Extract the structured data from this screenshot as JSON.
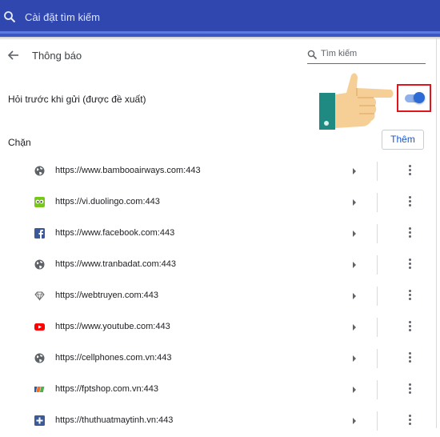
{
  "header": {
    "search_placeholder": "Cài đặt tìm kiếm",
    "search_icon": "search-icon"
  },
  "subpage": {
    "back_icon": "arrow-back-icon",
    "title": "Thông báo",
    "search_placeholder": "Tìm kiếm"
  },
  "ask_setting": {
    "label": "Hỏi trước khi gửi (được đề xuất)",
    "enabled": true,
    "toggle_color": "#2c6ad6",
    "highlight_color": "#e0161c"
  },
  "blocked": {
    "label": "Chặn",
    "add_button": "Thêm",
    "sites": [
      {
        "url": "https://www.bambooairways.com:443",
        "icon": "globe-icon"
      },
      {
        "url": "https://vi.duolingo.com:443",
        "icon": "duolingo-icon"
      },
      {
        "url": "https://www.facebook.com:443",
        "icon": "facebook-icon"
      },
      {
        "url": "https://www.tranbadat.com:443",
        "icon": "globe-icon"
      },
      {
        "url": "https://webtruyen.com:443",
        "icon": "diamond-icon"
      },
      {
        "url": "https://www.youtube.com:443",
        "icon": "youtube-icon"
      },
      {
        "url": "https://cellphones.com.vn:443",
        "icon": "globe-icon"
      },
      {
        "url": "https://fptshop.com.vn:443",
        "icon": "fpt-icon"
      },
      {
        "url": "https://thuthuatmaytinh.vn:443",
        "icon": "plus-square-icon"
      }
    ]
  },
  "colors": {
    "header": "#2f47ae",
    "accent": "#1a56c4"
  }
}
